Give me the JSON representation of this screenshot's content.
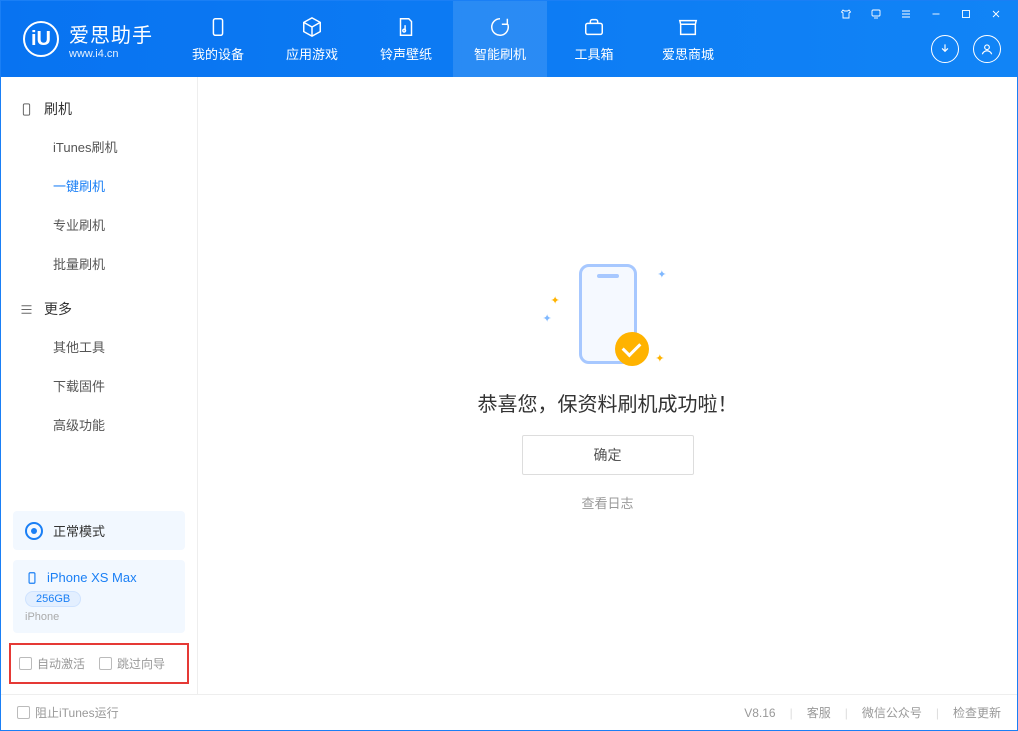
{
  "app": {
    "name_cn": "爱思助手",
    "name_en": "www.i4.cn"
  },
  "nav": {
    "items": [
      {
        "label": "我的设备"
      },
      {
        "label": "应用游戏"
      },
      {
        "label": "铃声壁纸"
      },
      {
        "label": "智能刷机"
      },
      {
        "label": "工具箱"
      },
      {
        "label": "爱思商城"
      }
    ],
    "active_index": 3
  },
  "sidebar": {
    "group1_label": "刷机",
    "group1_items": [
      "iTunes刷机",
      "一键刷机",
      "专业刷机",
      "批量刷机"
    ],
    "group1_active_index": 1,
    "group2_label": "更多",
    "group2_items": [
      "其他工具",
      "下载固件",
      "高级功能"
    ]
  },
  "mode_card": {
    "label": "正常模式"
  },
  "device_card": {
    "name": "iPhone XS Max",
    "storage": "256GB",
    "type": "iPhone"
  },
  "bottom_options": {
    "auto_activate": "自动激活",
    "skip_guide": "跳过向导"
  },
  "main": {
    "success_text": "恭喜您，保资料刷机成功啦！",
    "ok_button": "确定",
    "view_log": "查看日志"
  },
  "statusbar": {
    "block_itunes": "阻止iTunes运行",
    "version": "V8.16",
    "links": [
      "客服",
      "微信公众号",
      "检查更新"
    ]
  }
}
